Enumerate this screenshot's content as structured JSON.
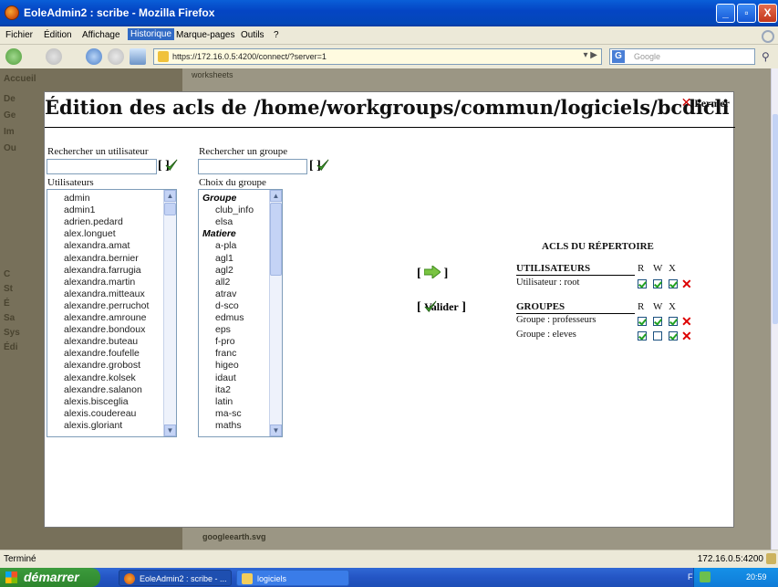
{
  "window": {
    "title": "EoleAdmin2 : scribe - Mozilla Firefox",
    "controls": [
      "_",
      "▫",
      "X"
    ]
  },
  "menubar": {
    "items": [
      "Fichier",
      "Édition",
      "Affichage",
      "Historique",
      "Marque-pages",
      "Outils",
      "?"
    ],
    "highlighted": "Historique"
  },
  "navbar": {
    "url": "https://172.16.0.5:4200/connect/?server=1",
    "search_placeholder": "Google",
    "search_engine": "G"
  },
  "background": {
    "sidebar_items": [
      "Accueil",
      "De",
      "Ge",
      "Im",
      "Ou",
      "C",
      "St",
      "É",
      "Sa",
      "Sys",
      "Édi"
    ],
    "tree_item": "worksheets",
    "footer_link": "googleearth.svg"
  },
  "dialog": {
    "title": "Édition des acls de /home/workgroups/commun/logiciels/bcdicli",
    "close_label": "Fermer",
    "search_user_label": "Rechercher un utilisateur",
    "search_group_label": "Rechercher un groupe",
    "search_user_value": "",
    "search_group_value": "",
    "users_label": "Utilisateurs",
    "groups_label": "Choix du groupe",
    "users": [
      "admin",
      "admin1",
      "adrien.pedard",
      "alex.longuet",
      "alexandra.amat",
      "alexandra.bernier",
      "alexandra.farrugia",
      "alexandra.martin",
      "alexandra.mitteaux",
      "alexandre.perruchot",
      "alexandre.amroune",
      "alexandre.bondoux",
      "alexandre.buteau",
      "alexandre.foufelle",
      "alexandre.grobost",
      "alexandre.kolsek",
      "alexandre.salanon",
      "alexis.bisceglia",
      "alexis.coudereau",
      "alexis.gloriant"
    ],
    "groups": [
      {
        "type": "header",
        "label": "Groupe"
      },
      {
        "type": "item",
        "label": "club_info"
      },
      {
        "type": "item",
        "label": "elsa"
      },
      {
        "type": "header",
        "label": "Matiere"
      },
      {
        "type": "item",
        "label": "a-pla"
      },
      {
        "type": "item",
        "label": "agl1"
      },
      {
        "type": "item",
        "label": "agl2"
      },
      {
        "type": "item",
        "label": "all2"
      },
      {
        "type": "item",
        "label": "atrav"
      },
      {
        "type": "item",
        "label": "d-sco"
      },
      {
        "type": "item",
        "label": "edmus"
      },
      {
        "type": "item",
        "label": "eps"
      },
      {
        "type": "item",
        "label": "f-pro"
      },
      {
        "type": "item",
        "label": "franc"
      },
      {
        "type": "item",
        "label": "higeo"
      },
      {
        "type": "item",
        "label": "idaut"
      },
      {
        "type": "item",
        "label": "ita2"
      },
      {
        "type": "item",
        "label": "latin"
      },
      {
        "type": "item",
        "label": "ma-sc"
      },
      {
        "type": "item",
        "label": "maths"
      }
    ],
    "validate_label": "Valider",
    "acls_title": "ACLS DU RÉPERTOIRE",
    "rwx": [
      "R",
      "W",
      "X"
    ],
    "users_section": "UTILISATEURS",
    "groups_section": "GROUPES",
    "user_acls": [
      {
        "label": "Utilisateur : root",
        "r": true,
        "w": true,
        "x": true
      }
    ],
    "group_acls": [
      {
        "label": "Groupe : professeurs",
        "r": true,
        "w": true,
        "x": true
      },
      {
        "label": "Groupe : eleves",
        "r": true,
        "w": false,
        "x": true
      }
    ]
  },
  "statusbar": {
    "status": "Terminé",
    "host": "172.16.0.5:4200"
  },
  "taskbar": {
    "start": "démarrer",
    "tasks": [
      "EoleAdmin2 : scribe - ...",
      "logiciels"
    ],
    "lang": "FR",
    "clock": "20:59"
  }
}
